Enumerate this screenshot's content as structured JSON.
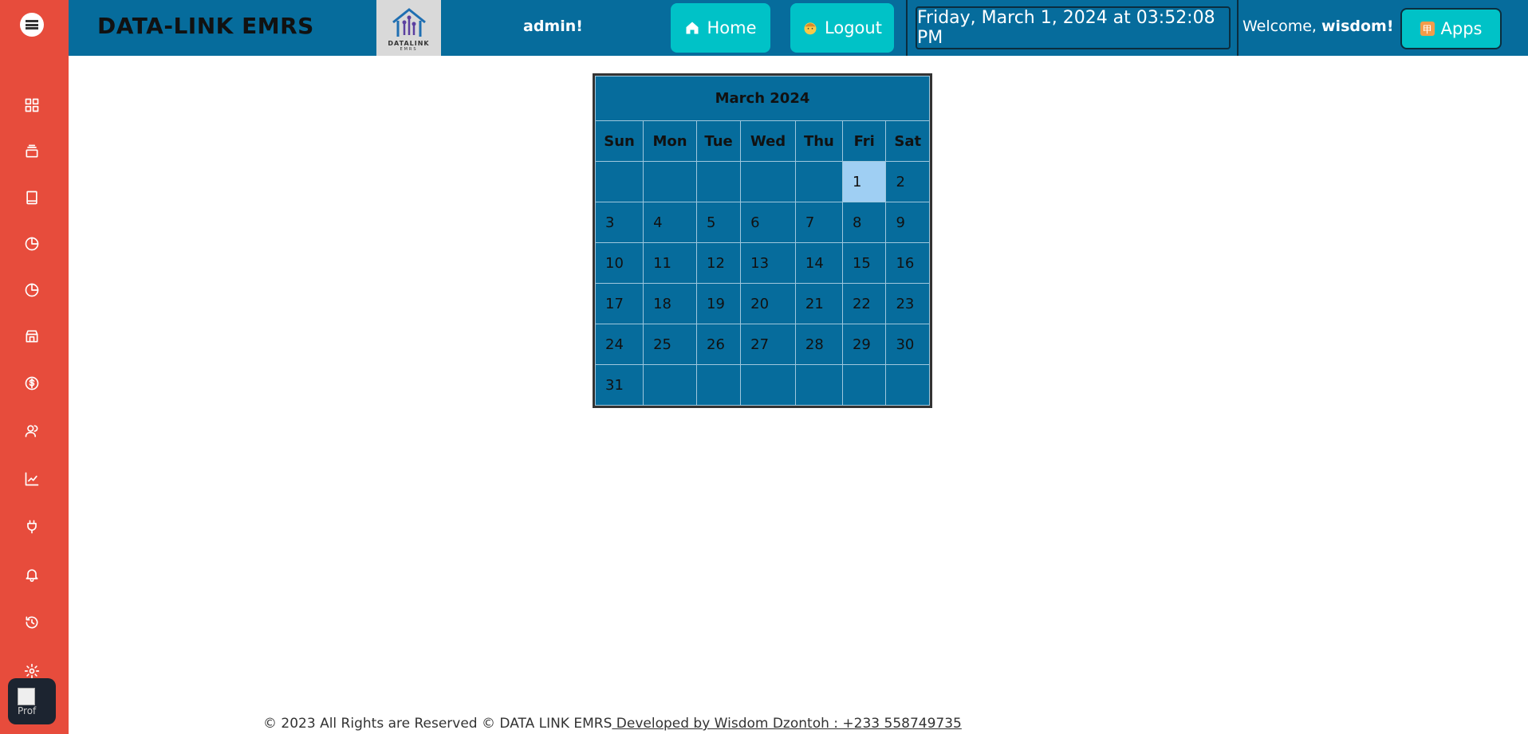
{
  "header": {
    "brand": "DATA-LINK EMRS",
    "logo_text": "DATALINK",
    "logo_sub": "EMRS",
    "user_label": "admin!",
    "home_label": "Home",
    "logout_label": "Logout",
    "datetime": "Friday, March 1, 2024 at 03:52:08 PM",
    "welcome_prefix": "Welcome,",
    "welcome_name": "wisdom!",
    "apps_label": "Apps"
  },
  "sidebar": {
    "items": [
      {
        "icon": "grid-icon"
      },
      {
        "icon": "stack-icon"
      },
      {
        "icon": "book-icon"
      },
      {
        "icon": "pie-chart-icon"
      },
      {
        "icon": "pie-chart-icon"
      },
      {
        "icon": "store-icon"
      },
      {
        "icon": "dollar-icon"
      },
      {
        "icon": "users-icon"
      },
      {
        "icon": "line-chart-icon"
      },
      {
        "icon": "plug-icon"
      },
      {
        "icon": "bell-icon"
      },
      {
        "icon": "history-icon"
      },
      {
        "icon": "gear-icon"
      }
    ],
    "profile_alt": "Prof"
  },
  "calendar": {
    "title": "March 2024",
    "weekdays": [
      "Sun",
      "Mon",
      "Tue",
      "Wed",
      "Thu",
      "Fri",
      "Sat"
    ],
    "weeks": [
      [
        "",
        "",
        "",
        "",
        "",
        "1",
        "2"
      ],
      [
        "3",
        "4",
        "5",
        "6",
        "7",
        "8",
        "9"
      ],
      [
        "10",
        "11",
        "12",
        "13",
        "14",
        "15",
        "16"
      ],
      [
        "17",
        "18",
        "19",
        "20",
        "21",
        "22",
        "23"
      ],
      [
        "24",
        "25",
        "26",
        "27",
        "28",
        "29",
        "30"
      ],
      [
        "31",
        "",
        "",
        "",
        "",
        "",
        ""
      ]
    ],
    "today": "1"
  },
  "footer": {
    "text": "© 2023 All Rights are Reserved © DATA LINK EMRS",
    "link": " Developed by Wisdom Dzontoh : +233 558749735"
  },
  "colors": {
    "sidebar": "#e74c3c",
    "header": "#066c9c",
    "accent_button": "#00c2c7",
    "today_highlight": "#9fcff3"
  }
}
